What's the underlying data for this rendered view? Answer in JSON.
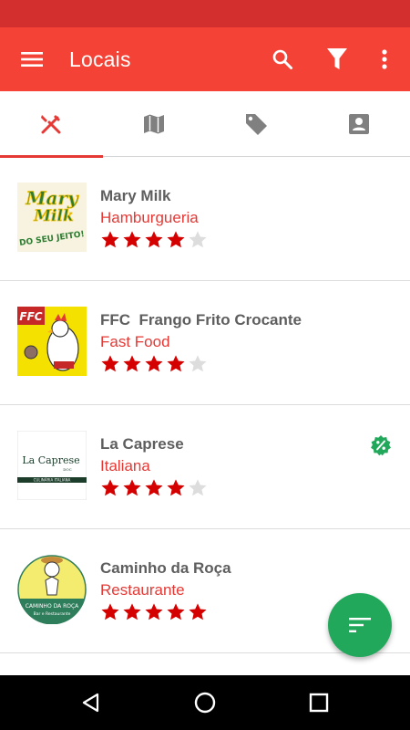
{
  "toolbar": {
    "title": "Locais",
    "color": "#f44336",
    "status_color": "#d32f2f",
    "icons": [
      "menu-icon",
      "search-icon",
      "filter-icon",
      "more-vert-icon"
    ]
  },
  "tabs": [
    {
      "icon": "restaurant-icon",
      "active": true
    },
    {
      "icon": "map-icon",
      "active": false
    },
    {
      "icon": "tag-icon",
      "active": false
    },
    {
      "icon": "contact-icon",
      "active": false
    }
  ],
  "places": [
    {
      "name": "Mary Milk",
      "category": "Hamburgueria",
      "rating": 4,
      "max_rating": 5,
      "promo": false,
      "logo": {
        "line1": "Mary",
        "line2": "Milk",
        "line3": "DO SEU JEITO!"
      }
    },
    {
      "name": "FFC  Frango Frito Crocante",
      "category": "Fast Food",
      "rating": 4,
      "max_rating": 5,
      "promo": false,
      "logo": {
        "line1": "FFC"
      }
    },
    {
      "name": "La Caprese",
      "category": "Italiana",
      "rating": 4,
      "max_rating": 5,
      "promo": true,
      "logo": {
        "line1": "La Caprese",
        "line2": "DOC",
        "line3": "CULINÁRIA ITALIANA"
      }
    },
    {
      "name": "Caminho da Roça",
      "category": "Restaurante",
      "rating": 5,
      "max_rating": 5,
      "promo": false,
      "logo": {
        "line1": "CAMINHO DA ROÇA",
        "line2": "Bar e Restaurante"
      }
    }
  ],
  "colors": {
    "accent": "#e53935",
    "star_on": "#d50000",
    "star_off": "#dddddd",
    "promo": "#22a85b",
    "fab": "#22a85b"
  },
  "fab": {
    "icon": "sort-icon"
  },
  "nav": {
    "icons": [
      "back-icon",
      "home-icon",
      "recents-icon"
    ]
  }
}
